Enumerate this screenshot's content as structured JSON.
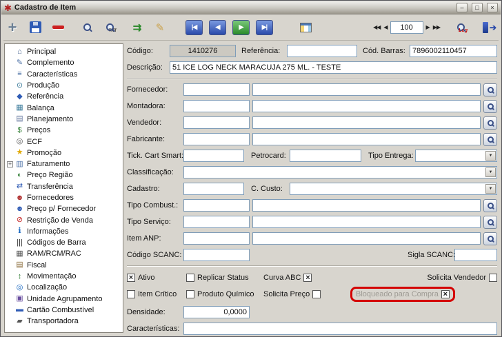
{
  "window": {
    "title": "Cadastro de Item",
    "icon_glyph": "✱",
    "controls": {
      "minimize": "–",
      "maximize": "□",
      "close": "×"
    }
  },
  "toolbar": {
    "pager_value": "100",
    "icons": {
      "plus": "+",
      "pen": "✎",
      "export": "⇉",
      "txt_label": "TXT",
      "log_label": "Log",
      "nav_first": "|◀",
      "nav_prev": "◀",
      "nav_next": "▶",
      "nav_last": "▶|",
      "pg_first": "◀◀",
      "pg_prev": "◀",
      "pg_next": "▶",
      "pg_last": "▶▶",
      "dropdown_arrow": "▼",
      "exit_arrow": "➔"
    }
  },
  "sidebar": {
    "items": [
      {
        "label": "Principal",
        "glyph": "⌂",
        "color": "#44618e"
      },
      {
        "label": "Complemento",
        "glyph": "✎",
        "color": "#4a6fa5"
      },
      {
        "label": "Características",
        "glyph": "≡",
        "color": "#4a6fa5"
      },
      {
        "label": "Produção",
        "glyph": "⊙",
        "color": "#3a7a9a"
      },
      {
        "label": "Referência",
        "glyph": "◆",
        "color": "#2f5bb5"
      },
      {
        "label": "Balança",
        "glyph": "▦",
        "color": "#3a7a9a"
      },
      {
        "label": "Planejamento",
        "glyph": "▤",
        "color": "#6a7ba2"
      },
      {
        "label": "Preços",
        "glyph": "$",
        "color": "#2e7d32"
      },
      {
        "label": "ECF",
        "glyph": "◎",
        "color": "#555555"
      },
      {
        "label": "Promoção",
        "glyph": "★",
        "color": "#e0a800"
      },
      {
        "label": "Faturamento",
        "glyph": "▥",
        "color": "#4a6fa5",
        "expander": "+"
      },
      {
        "label": "Preço Região",
        "glyph": "◐",
        "color": "#2e7d32"
      },
      {
        "label": "Transferência",
        "glyph": "⇄",
        "color": "#2f5bb5"
      },
      {
        "label": "Fornecedores",
        "glyph": "☻",
        "color": "#b03030"
      },
      {
        "label": "Preço p/ Fornecedor",
        "glyph": "☻",
        "color": "#2f5bb5"
      },
      {
        "label": "Restrição de Venda",
        "glyph": "⊘",
        "color": "#c62828"
      },
      {
        "label": "Informações",
        "glyph": "ℹ",
        "color": "#1565c0"
      },
      {
        "label": "Códigos de Barra",
        "glyph": "|||",
        "color": "#222222"
      },
      {
        "label": "RAM/RCM/RAC",
        "glyph": "▦",
        "color": "#555555"
      },
      {
        "label": "Fiscal",
        "glyph": "▤",
        "color": "#8a6d3b"
      },
      {
        "label": "Movimentação",
        "glyph": "↕",
        "color": "#2e7d32"
      },
      {
        "label": "Localização",
        "glyph": "◎",
        "color": "#1565c0"
      },
      {
        "label": "Unidade Agrupamento",
        "glyph": "▣",
        "color": "#6a4fa0"
      },
      {
        "label": "Cartão Combustível",
        "glyph": "▬",
        "color": "#2f5bb5"
      },
      {
        "label": "Transportadora",
        "glyph": "▰",
        "color": "#555555"
      }
    ]
  },
  "form": {
    "codigo": {
      "label": "Código:",
      "value": "1410276"
    },
    "referencia": {
      "label": "Referência:",
      "value": ""
    },
    "cod_barras": {
      "label": "Cód. Barras:",
      "value": "7896002110457"
    },
    "descricao": {
      "label": "Descrição:",
      "value": "51 ICE LOG NECK MARACUJA 275 ML. - TESTE"
    },
    "fornecedor": {
      "label": "Fornecedor:",
      "code": "",
      "name": ""
    },
    "montadora": {
      "label": "Montadora:",
      "code": "",
      "name": ""
    },
    "vendedor": {
      "label": "Vendedor:",
      "code": "",
      "name": ""
    },
    "fabricante": {
      "label": "Fabricante:",
      "code": "",
      "name": ""
    },
    "tick_cart_smart": {
      "label": "Tick. Cart Smart:",
      "value": ""
    },
    "petrocard": {
      "label": "Petrocard:",
      "value": ""
    },
    "tipo_entrega": {
      "label": "Tipo Entrega:",
      "value": ""
    },
    "classificacao": {
      "label": "Classificação:",
      "value": ""
    },
    "cadastro": {
      "label": "Cadastro:",
      "value": ""
    },
    "c_custo": {
      "label": "C. Custo:",
      "value": ""
    },
    "tipo_combust": {
      "label": "Tipo Combust.:",
      "code": "",
      "name": ""
    },
    "tipo_servico": {
      "label": "Tipo Serviço:",
      "code": "",
      "name": ""
    },
    "item_anp": {
      "label": "Item ANP:",
      "code": "",
      "name": ""
    },
    "codigo_scanc": {
      "label": "Código SCANC:",
      "value": ""
    },
    "sigla_scanc": {
      "label": "Sigla SCANC:",
      "value": ""
    },
    "checkboxes": {
      "ativo": {
        "label": "Ativo",
        "checked": true
      },
      "replicar_status": {
        "label": "Replicar Status",
        "checked": false
      },
      "curva_abc": {
        "label": "Curva ABC",
        "checked": true
      },
      "solicita_vendedor": {
        "label": "Solicita Vendedor",
        "checked": false
      },
      "item_critico": {
        "label": "Item Crítico",
        "checked": false
      },
      "produto_quimico": {
        "label": "Produto Químico",
        "checked": false
      },
      "solicita_preco": {
        "label": "Solicita Preço",
        "checked": false
      },
      "bloqueado_compra": {
        "label": "Bloqueado para Compra",
        "checked": true
      }
    },
    "densidade": {
      "label": "Densidade:",
      "value": "0,0000"
    },
    "caracteristicas": {
      "label": "Características:",
      "value": ""
    }
  }
}
